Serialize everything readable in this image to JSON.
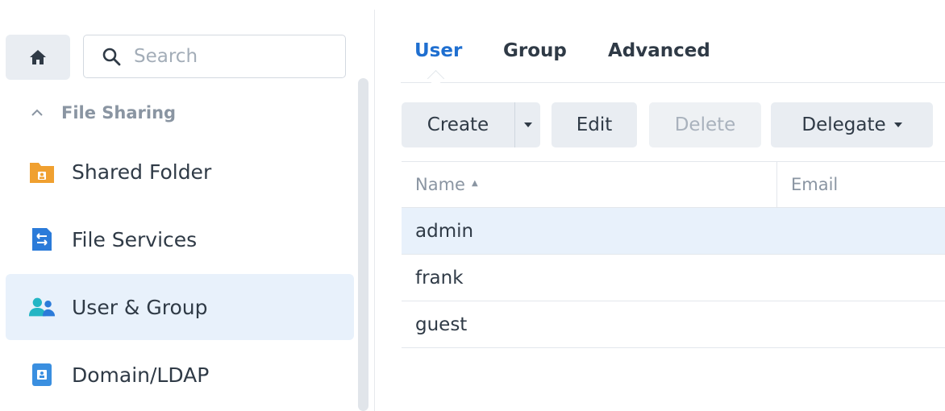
{
  "search": {
    "placeholder": "Search"
  },
  "sidebar": {
    "section_title": "File Sharing",
    "items": [
      {
        "label": "Shared Folder",
        "icon": "shared-folder-icon",
        "color": "#f0a030"
      },
      {
        "label": "File Services",
        "icon": "file-services-icon",
        "color": "#2b7bd9"
      },
      {
        "label": "User & Group",
        "icon": "user-group-icon",
        "color": "#23b5c4",
        "active": true
      },
      {
        "label": "Domain/LDAP",
        "icon": "domain-ldap-icon",
        "color": "#3a8fe0"
      }
    ]
  },
  "tabs": [
    {
      "label": "User",
      "active": true
    },
    {
      "label": "Group"
    },
    {
      "label": "Advanced"
    }
  ],
  "toolbar": {
    "create_label": "Create",
    "edit_label": "Edit",
    "delete_label": "Delete",
    "delegate_label": "Delegate"
  },
  "table": {
    "columns": [
      "Name",
      "Email"
    ],
    "sort_indicator": "▲",
    "rows": [
      {
        "name": "admin",
        "email": "",
        "selected": true
      },
      {
        "name": "frank",
        "email": ""
      },
      {
        "name": "guest",
        "email": ""
      }
    ]
  },
  "colors": {
    "accent": "#1f6fd0",
    "selection": "#e8f1fb",
    "button": "#e9edf2"
  }
}
